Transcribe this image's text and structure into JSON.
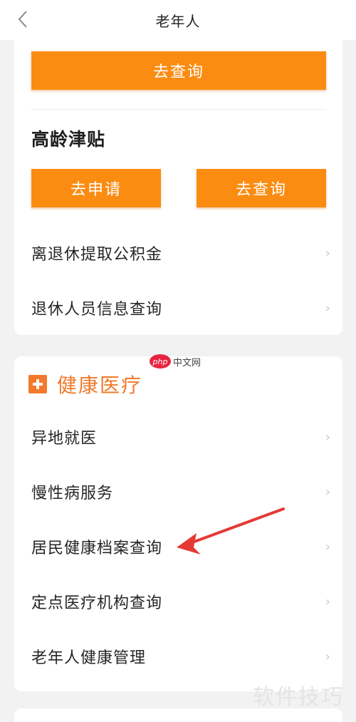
{
  "nav": {
    "title": "老年人",
    "back_icon": "chevron-left-icon"
  },
  "elderly_card": {
    "top_query_label": "去查询",
    "section_title": "高龄津贴",
    "apply_label": "去申请",
    "query_label": "去查询",
    "items": [
      {
        "label": "离退休提取公积金"
      },
      {
        "label": "退休人员信息查询"
      }
    ]
  },
  "health_card": {
    "title": "健康医疗",
    "title_icon": "plus-box-icon",
    "items": [
      {
        "label": "异地就医"
      },
      {
        "label": "慢性病服务"
      },
      {
        "label": "居民健康档案查询"
      },
      {
        "label": "定点医疗机构查询"
      },
      {
        "label": "老年人健康管理"
      }
    ]
  },
  "watermarks": {
    "php_badge": "php",
    "php_text": "中文网",
    "skill_text": "软件技巧"
  },
  "colors": {
    "button_orange": "#fb8c12",
    "health_title": "#f07a2a",
    "annotation_arrow": "#e53935",
    "background": "#f2f2f2"
  }
}
